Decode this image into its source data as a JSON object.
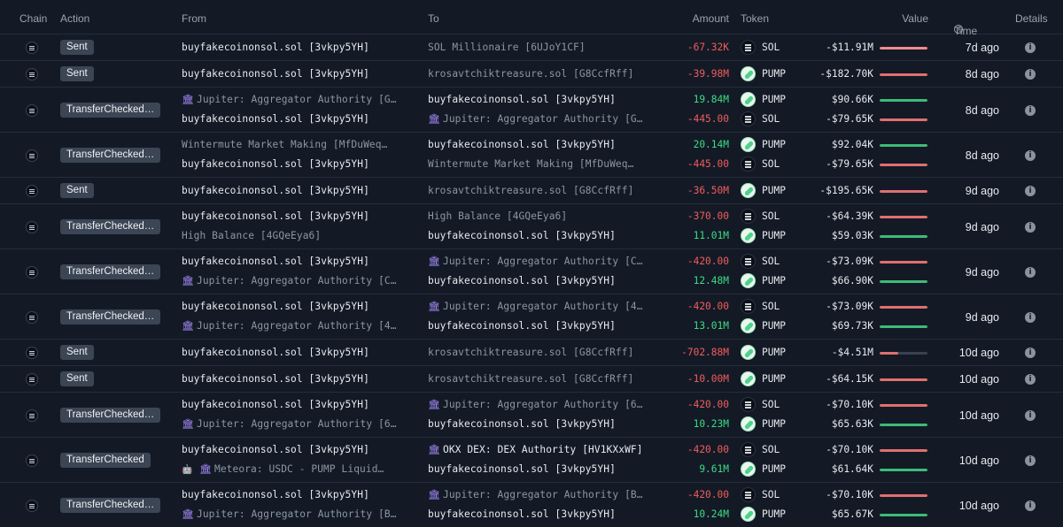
{
  "columns": {
    "chain": "Chain",
    "action": "Action",
    "from": "From",
    "to": "To",
    "amount": "Amount",
    "token": "Token",
    "value": "Value",
    "time": "Time",
    "details": "Details"
  },
  "colors": {
    "background": "#131a26",
    "negative": "#f25c5c",
    "positive": "#3ddc84",
    "bar_negative": "#e07070",
    "bar_positive": "#3dbb78",
    "badge": "#3b4554"
  },
  "rows": [
    {
      "action": "Sent",
      "time": "7d ago",
      "legs": [
        {
          "from": "buyfakecoinonsol.sol [3vkpy5YH]",
          "from_style": "bright",
          "to": "SOL Millionaire [6UJoY1CF]",
          "to_style": "dim",
          "amount": "-67.32K",
          "token": "SOL",
          "value": "-$11.91M",
          "bar_pct": 100,
          "bar_sign": "neg"
        }
      ]
    },
    {
      "action": "Sent",
      "time": "8d ago",
      "legs": [
        {
          "from": "buyfakecoinonsol.sol [3vkpy5YH]",
          "from_style": "bright",
          "to": "krosavtchiktreasure.sol [G8CcfRff]",
          "to_style": "dim",
          "amount": "-39.98M",
          "token": "PUMP",
          "value": "-$182.70K",
          "bar_pct": 100,
          "bar_sign": "neg"
        }
      ]
    },
    {
      "action": "TransferChecked…",
      "time": "8d ago",
      "legs": [
        {
          "from": "Jupiter: Aggregator Authority [G…",
          "from_style": "dim",
          "from_icon": "bank",
          "to": "buyfakecoinonsol.sol [3vkpy5YH]",
          "to_style": "bright",
          "amount": "19.84M",
          "token": "PUMP",
          "value": "$90.66K",
          "bar_pct": 100,
          "bar_sign": "pos"
        },
        {
          "from": "buyfakecoinonsol.sol [3vkpy5YH]",
          "from_style": "bright",
          "to": "Jupiter: Aggregator Authority [G…",
          "to_style": "dim",
          "to_icon": "bank",
          "amount": "-445.00",
          "token": "SOL",
          "value": "-$79.65K",
          "bar_pct": 100,
          "bar_sign": "neg"
        }
      ]
    },
    {
      "action": "TransferChecked…",
      "time": "8d ago",
      "legs": [
        {
          "from": "Wintermute Market Making [MfDuWeq…",
          "from_style": "dim",
          "to": "buyfakecoinonsol.sol [3vkpy5YH]",
          "to_style": "bright",
          "amount": "20.14M",
          "token": "PUMP",
          "value": "$92.04K",
          "bar_pct": 100,
          "bar_sign": "pos"
        },
        {
          "from": "buyfakecoinonsol.sol [3vkpy5YH]",
          "from_style": "bright",
          "to": "Wintermute Market Making [MfDuWeq…",
          "to_style": "dim",
          "amount": "-445.00",
          "token": "SOL",
          "value": "-$79.65K",
          "bar_pct": 100,
          "bar_sign": "neg"
        }
      ]
    },
    {
      "action": "Sent",
      "time": "9d ago",
      "legs": [
        {
          "from": "buyfakecoinonsol.sol [3vkpy5YH]",
          "from_style": "bright",
          "to": "krosavtchiktreasure.sol [G8CcfRff]",
          "to_style": "dim",
          "amount": "-36.50M",
          "token": "PUMP",
          "value": "-$195.65K",
          "bar_pct": 100,
          "bar_sign": "neg"
        }
      ]
    },
    {
      "action": "TransferChecked…",
      "time": "9d ago",
      "legs": [
        {
          "from": "buyfakecoinonsol.sol [3vkpy5YH]",
          "from_style": "bright",
          "to": "High Balance [4GQeEya6]",
          "to_style": "dim",
          "amount": "-370.00",
          "token": "SOL",
          "value": "-$64.39K",
          "bar_pct": 100,
          "bar_sign": "neg"
        },
        {
          "from": "High Balance [4GQeEya6]",
          "from_style": "dim",
          "to": "buyfakecoinonsol.sol [3vkpy5YH]",
          "to_style": "bright",
          "amount": "11.01M",
          "token": "PUMP",
          "value": "$59.03K",
          "bar_pct": 100,
          "bar_sign": "pos"
        }
      ]
    },
    {
      "action": "TransferChecked…",
      "time": "9d ago",
      "legs": [
        {
          "from": "buyfakecoinonsol.sol [3vkpy5YH]",
          "from_style": "bright",
          "to": "Jupiter: Aggregator Authority [C…",
          "to_style": "dim",
          "to_icon": "bank",
          "amount": "-420.00",
          "token": "SOL",
          "value": "-$73.09K",
          "bar_pct": 100,
          "bar_sign": "neg"
        },
        {
          "from": "Jupiter: Aggregator Authority [C…",
          "from_style": "dim",
          "from_icon": "bank",
          "to": "buyfakecoinonsol.sol [3vkpy5YH]",
          "to_style": "bright",
          "amount": "12.48M",
          "token": "PUMP",
          "value": "$66.90K",
          "bar_pct": 100,
          "bar_sign": "pos"
        }
      ]
    },
    {
      "action": "TransferChecked…",
      "time": "9d ago",
      "legs": [
        {
          "from": "buyfakecoinonsol.sol [3vkpy5YH]",
          "from_style": "bright",
          "to": "Jupiter: Aggregator Authority [4…",
          "to_style": "dim",
          "to_icon": "bank",
          "amount": "-420.00",
          "token": "SOL",
          "value": "-$73.09K",
          "bar_pct": 100,
          "bar_sign": "neg"
        },
        {
          "from": "Jupiter: Aggregator Authority [4…",
          "from_style": "dim",
          "from_icon": "bank",
          "to": "buyfakecoinonsol.sol [3vkpy5YH]",
          "to_style": "bright",
          "amount": "13.01M",
          "token": "PUMP",
          "value": "$69.73K",
          "bar_pct": 100,
          "bar_sign": "pos"
        }
      ]
    },
    {
      "action": "Sent",
      "time": "10d ago",
      "legs": [
        {
          "from": "buyfakecoinonsol.sol [3vkpy5YH]",
          "from_style": "bright",
          "to": "krosavtchiktreasure.sol [G8CcfRff]",
          "to_style": "dim",
          "amount": "-702.88M",
          "token": "PUMP",
          "value": "-$4.51M",
          "bar_pct": 38,
          "bar_sign": "neg"
        }
      ]
    },
    {
      "action": "Sent",
      "time": "10d ago",
      "legs": [
        {
          "from": "buyfakecoinonsol.sol [3vkpy5YH]",
          "from_style": "bright",
          "to": "krosavtchiktreasure.sol [G8CcfRff]",
          "to_style": "dim",
          "amount": "-10.00M",
          "token": "PUMP",
          "value": "-$64.15K",
          "bar_pct": 100,
          "bar_sign": "neg"
        }
      ]
    },
    {
      "action": "TransferChecked…",
      "time": "10d ago",
      "legs": [
        {
          "from": "buyfakecoinonsol.sol [3vkpy5YH]",
          "from_style": "bright",
          "to": "Jupiter: Aggregator Authority [6…",
          "to_style": "dim",
          "to_icon": "bank",
          "amount": "-420.00",
          "token": "SOL",
          "value": "-$70.10K",
          "bar_pct": 100,
          "bar_sign": "neg"
        },
        {
          "from": "Jupiter: Aggregator Authority [6…",
          "from_style": "dim",
          "from_icon": "bank",
          "to": "buyfakecoinonsol.sol [3vkpy5YH]",
          "to_style": "bright",
          "amount": "10.23M",
          "token": "PUMP",
          "value": "$65.63K",
          "bar_pct": 100,
          "bar_sign": "pos"
        }
      ]
    },
    {
      "action": "TransferChecked",
      "time": "10d ago",
      "legs": [
        {
          "from": "buyfakecoinonsol.sol [3vkpy5YH]",
          "from_style": "bright",
          "to": "OKX DEX: DEX Authority [HV1KXxWF]",
          "to_style": "bright",
          "to_icon": "bank",
          "amount": "-420.00",
          "token": "SOL",
          "value": "-$70.10K",
          "bar_pct": 100,
          "bar_sign": "neg"
        },
        {
          "from": "Meteora: USDC - PUMP Liquid…",
          "from_style": "dim",
          "from_icon": "robot-bank",
          "to": "buyfakecoinonsol.sol [3vkpy5YH]",
          "to_style": "bright",
          "amount": "9.61M",
          "token": "PUMP",
          "value": "$61.64K",
          "bar_pct": 100,
          "bar_sign": "pos"
        }
      ]
    },
    {
      "action": "TransferChecked…",
      "time": "10d ago",
      "legs": [
        {
          "from": "buyfakecoinonsol.sol [3vkpy5YH]",
          "from_style": "bright",
          "to": "Jupiter: Aggregator Authority [B…",
          "to_style": "dim",
          "to_icon": "bank",
          "amount": "-420.00",
          "token": "SOL",
          "value": "-$70.10K",
          "bar_pct": 100,
          "bar_sign": "neg"
        },
        {
          "from": "Jupiter: Aggregator Authority [B…",
          "from_style": "dim",
          "from_icon": "bank",
          "to": "buyfakecoinonsol.sol [3vkpy5YH]",
          "to_style": "bright",
          "amount": "10.24M",
          "token": "PUMP",
          "value": "$65.67K",
          "bar_pct": 100,
          "bar_sign": "pos"
        }
      ]
    }
  ]
}
